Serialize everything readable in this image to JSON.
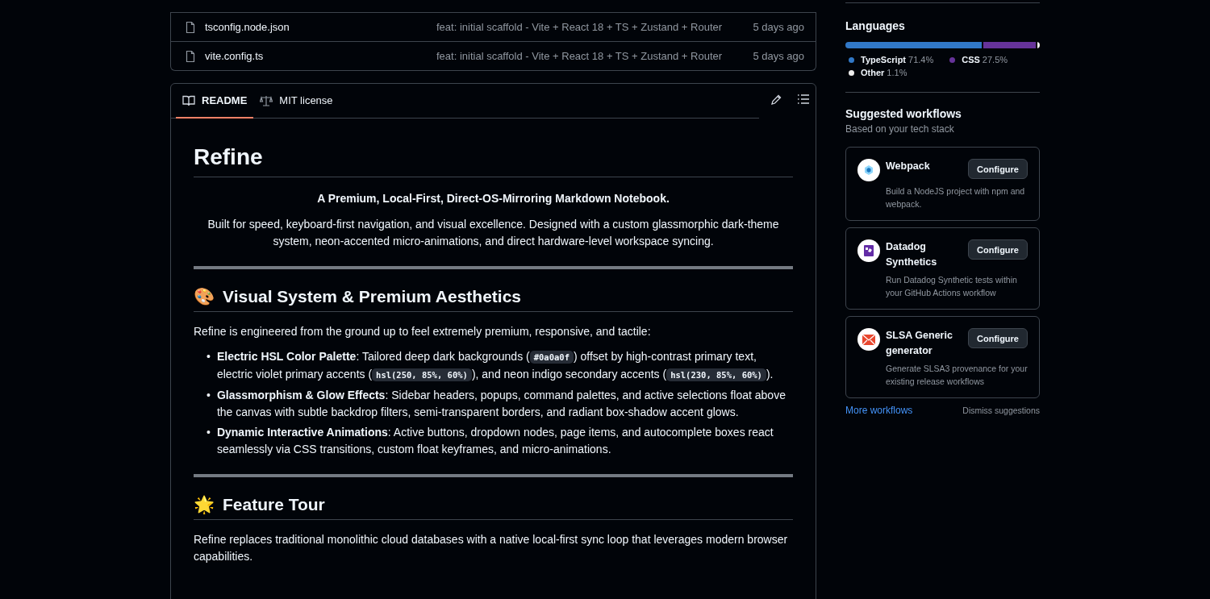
{
  "files": [
    {
      "name": "tsconfig.node.json",
      "commit": "feat: initial scaffold - Vite + React 18 + TS + Zustand + Router",
      "time": "5 days ago"
    },
    {
      "name": "vite.config.ts",
      "commit": "feat: initial scaffold - Vite + React 18 + TS + Zustand + Router",
      "time": "5 days ago"
    }
  ],
  "readme_tabs": [
    {
      "label": "README",
      "selected": true,
      "kind": "book"
    },
    {
      "label": "MIT license",
      "selected": false,
      "kind": "scale"
    }
  ],
  "readme": {
    "title": "Refine",
    "tagline": "A Premium, Local-First, Direct-OS-Mirroring Markdown Notebook.",
    "intro": "Built for speed, keyboard-first navigation, and visual excellence. Designed with a custom glassmorphic dark-theme system, neon-accented micro-animations, and direct hardware-level workspace syncing.",
    "sections": [
      {
        "emoji": "🎨",
        "heading": "Visual System & Premium Aesthetics",
        "text": "Refine is engineered from the ground up to feel extremely premium, responsive, and tactile:",
        "bullets": [
          {
            "marker": "•",
            "segments": [
              {
                "kind": "bold",
                "text": "Electric HSL Color Palette"
              },
              {
                "kind": "text",
                "text": ": Tailored deep dark backgrounds ("
              },
              {
                "kind": "code",
                "text": "#0a0a0f"
              },
              {
                "kind": "text",
                "text": ") offset by high-contrast primary text, electric violet primary accents ("
              },
              {
                "kind": "code",
                "text": "hsl(250, 85%, 60%)"
              },
              {
                "kind": "text",
                "text": "), and neon indigo secondary accents ("
              },
              {
                "kind": "code",
                "text": "hsl(230, 85%, 60%)"
              },
              {
                "kind": "text",
                "text": ")."
              }
            ]
          },
          {
            "marker": "•",
            "segments": [
              {
                "kind": "bold",
                "text": "Glassmorphism & Glow Effects"
              },
              {
                "kind": "text",
                "text": ": Sidebar headers, popups, command palettes, and active selections float above the canvas with subtle backdrop filters, semi-transparent borders, and radiant box-shadow accent glows."
              }
            ]
          },
          {
            "marker": "•",
            "segments": [
              {
                "kind": "bold",
                "text": "Dynamic Interactive Animations"
              },
              {
                "kind": "text",
                "text": ": Active buttons, dropdown nodes, page items, and autocomplete boxes react seamlessly via CSS transitions, custom float keyframes, and micro-animations."
              }
            ]
          }
        ]
      },
      {
        "emoji": "🌟",
        "heading": "Feature Tour",
        "text": "Refine replaces traditional monolithic cloud databases with a native local-first sync loop that leverages modern browser capabilities."
      }
    ]
  },
  "languages": {
    "title": "Languages",
    "items": [
      {
        "name": "TypeScript",
        "percent": "71.4%",
        "color": "#3178c6"
      },
      {
        "name": "CSS",
        "percent": "27.5%",
        "color": "#663399"
      },
      {
        "name": "Other",
        "percent": "1.1%",
        "color": "#ededed"
      }
    ]
  },
  "workflows": {
    "title": "Suggested workflows",
    "subtitle": "Based on your tech stack",
    "items": [
      {
        "name": "Webpack",
        "description": "Build a NodeJS project with npm and webpack.",
        "button": "Configure",
        "kind": "webpack"
      },
      {
        "name": "Datadog Synthetics",
        "description": "Run Datadog Synthetic tests within your GitHub Actions workflow",
        "button": "Configure",
        "kind": "datadog"
      },
      {
        "name": "SLSA Generic generator",
        "description": "Generate SLSA3 provenance for your existing release workflows",
        "button": "Configure",
        "kind": "slsa"
      }
    ],
    "more_link": "More workflows",
    "dismiss": "Dismiss suggestions"
  }
}
